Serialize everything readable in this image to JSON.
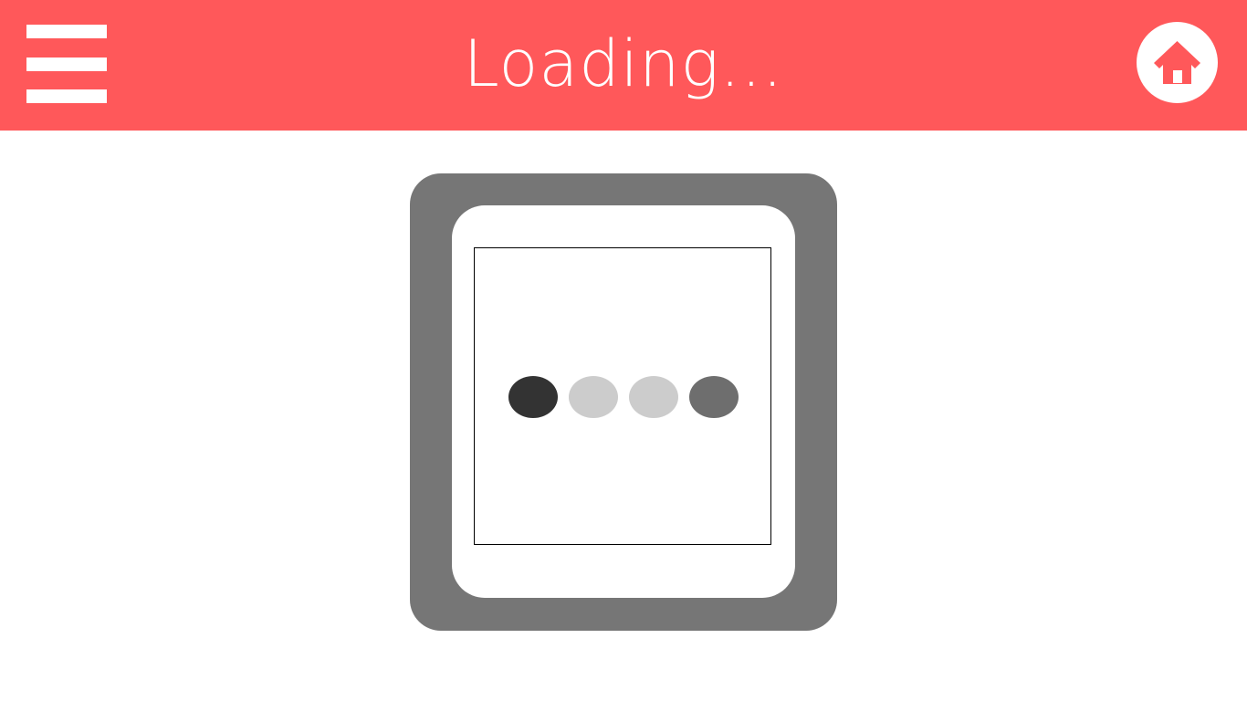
{
  "header": {
    "title": "Loading...",
    "background_color": "#ff585a",
    "menu_icon": "hamburger-menu-icon",
    "home_icon": "home-icon"
  },
  "loader": {
    "frame_color": "#767676",
    "dots": [
      {
        "color": "#333333"
      },
      {
        "color": "#cccccc"
      },
      {
        "color": "#cccccc"
      },
      {
        "color": "#6e6e6e"
      }
    ]
  }
}
